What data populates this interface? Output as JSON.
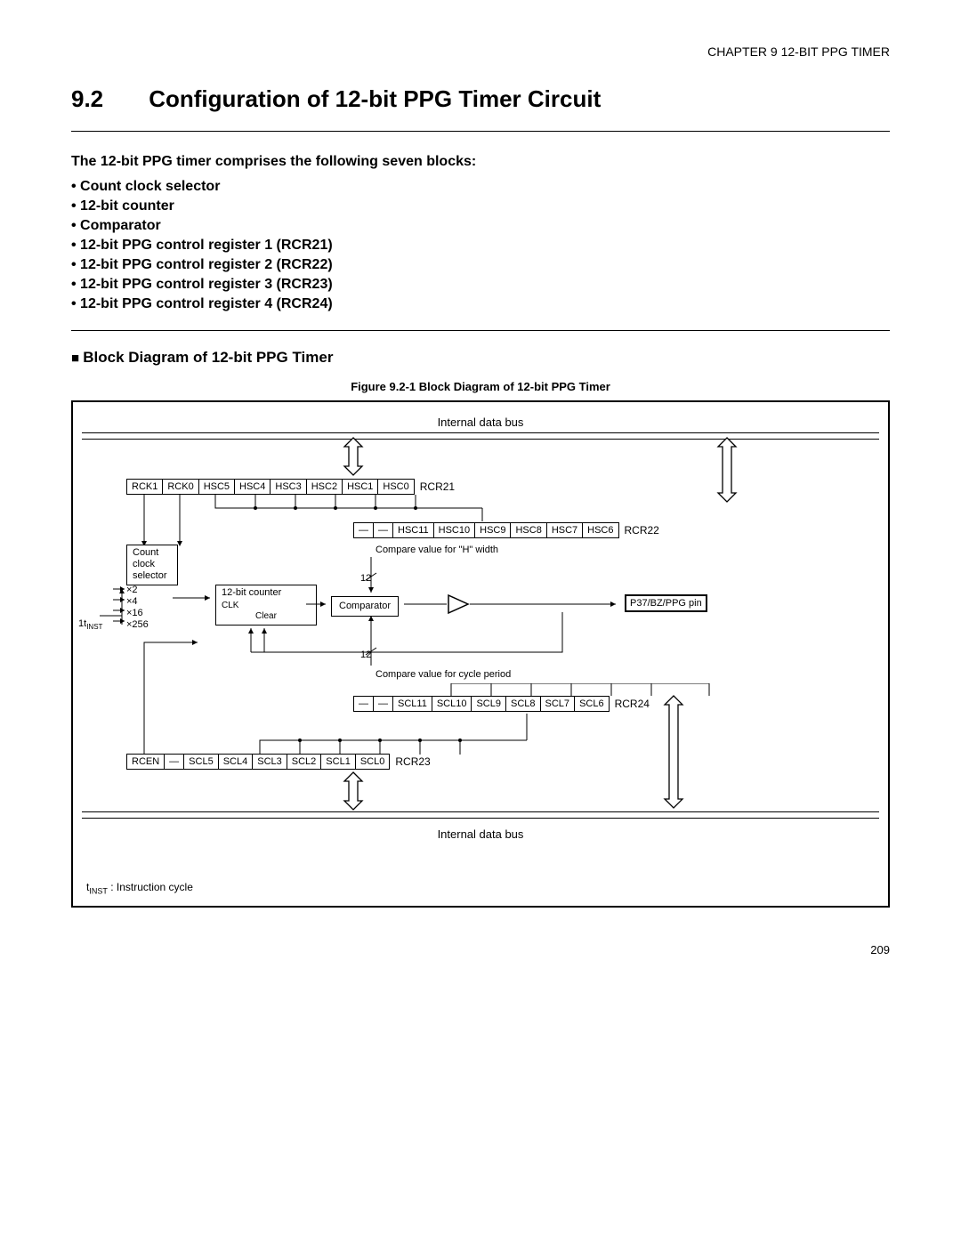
{
  "chapter_header": "CHAPTER 9  12-BIT PPG TIMER",
  "section_number": "9.2",
  "section_title": "Configuration of 12-bit PPG Timer Circuit",
  "intro": "The 12-bit PPG timer comprises the following seven blocks:",
  "bullets": [
    "Count clock selector",
    "12-bit counter",
    "Comparator",
    "12-bit PPG control register 1 (RCR21)",
    "12-bit PPG control register 2 (RCR22)",
    "12-bit PPG control register 3 (RCR23)",
    "12-bit PPG control register 4 (RCR24)"
  ],
  "subheading": "Block Diagram of 12-bit PPG Timer",
  "figure_caption": "Figure 9.2-1  Block Diagram of 12-bit PPG Timer",
  "diagram": {
    "bus_label_top": "Internal data bus",
    "bus_label_bottom": "Internal data bus",
    "rcr21_bits": [
      "RCK1",
      "RCK0",
      "HSC5",
      "HSC4",
      "HSC3",
      "HSC2",
      "HSC1",
      "HSC0"
    ],
    "rcr21_label": "RCR21",
    "rcr22_bits": [
      "—",
      "—",
      "HSC11",
      "HSC10",
      "HSC9",
      "HSC8",
      "HSC7",
      "HSC6"
    ],
    "rcr22_label": "RCR22",
    "rcr23_bits": [
      "RCEN",
      "—",
      "SCL5",
      "SCL4",
      "SCL3",
      "SCL2",
      "SCL1",
      "SCL0"
    ],
    "rcr23_label": "RCR23",
    "rcr24_bits": [
      "—",
      "—",
      "SCL11",
      "SCL10",
      "SCL9",
      "SCL8",
      "SCL7",
      "SCL6"
    ],
    "rcr24_label": "RCR24",
    "count_clock_selector": "Count\nclock\nselector",
    "mult0": "×2",
    "mult1": "×4",
    "mult2": "×16",
    "mult3": "×256",
    "tinst_in": "1t",
    "tinst_sub": "INST",
    "counter_label": "12-bit counter",
    "clk_label": "CLK",
    "clear_label": "Clear",
    "comparator_label": "Comparator",
    "pin_label": "P37/BZ/PPG pin",
    "compare_h": "Compare value for \"H\" width",
    "compare_cycle": "Compare value for cycle period",
    "twelve": "12",
    "footnote_prefix": "t",
    "footnote_sub": "INST",
    "footnote_text": " :  Instruction cycle"
  },
  "page_number": "209"
}
